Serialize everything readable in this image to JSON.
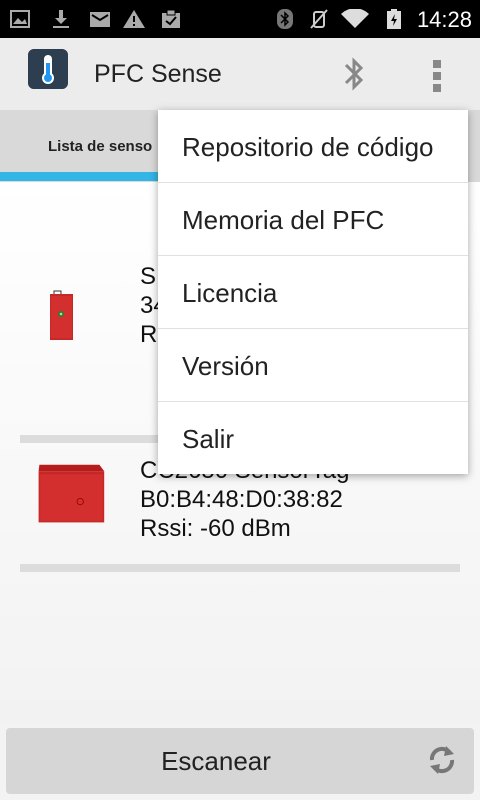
{
  "status_bar": {
    "time": "14:28",
    "icons": [
      "gallery-icon",
      "download-icon",
      "mail-icon",
      "warning-icon",
      "clipboard-check-icon",
      "bluetooth-icon",
      "mute-icon",
      "wifi-icon",
      "battery-icon"
    ]
  },
  "action_bar": {
    "title": "PFC Sense",
    "app_icon": "thermometer-icon",
    "actions": [
      "bluetooth-icon",
      "overflow-menu-icon"
    ]
  },
  "tabs": [
    {
      "label": "Lista de senso",
      "selected": true
    }
  ],
  "devices": [
    {
      "line1": "S",
      "line2": "34",
      "line3": "R",
      "image": "red-sensor-tag"
    },
    {
      "line1": "CC2650 SensorTag",
      "line2": "B0:B4:48:D0:38:82",
      "line3": "Rssi: -60 dBm",
      "image": "red-sensor-tag-case"
    }
  ],
  "menu": {
    "items": [
      "Repositorio de código",
      "Memoria del PFC",
      "Licencia",
      "Versión",
      "Salir"
    ]
  },
  "bottom_button": {
    "label": "Escanear",
    "icon": "refresh-icon"
  },
  "colors": {
    "tab_indicator": "#33b5e5",
    "action_bar": "#ececec",
    "tab_bar": "#d9d9d9",
    "device_red": "#c62828"
  }
}
